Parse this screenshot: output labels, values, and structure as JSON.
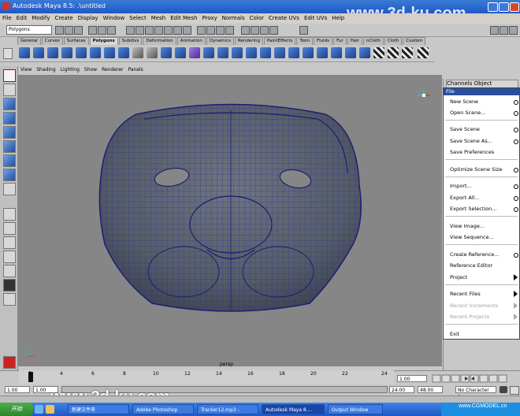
{
  "window": {
    "title": "Autodesk Maya 8.5: .\\untitled"
  },
  "menubar": [
    "File",
    "Edit",
    "Modify",
    "Create",
    "Display",
    "Window",
    "Select",
    "Mesh",
    "Edit Mesh",
    "Proxy",
    "Normals",
    "Color",
    "Create UVs",
    "Edit UVs",
    "Help"
  ],
  "statusline": {
    "mode": "Polygons"
  },
  "shelf": {
    "tabs": [
      "General",
      "Curves",
      "Surfaces",
      "Polygons",
      "Subdivs",
      "Deformation",
      "Animation",
      "Dynamics",
      "Rendering",
      "PaintEffects",
      "Toon",
      "Fluids",
      "Fur",
      "Hair",
      "nCloth",
      "Cloth",
      "Custom"
    ],
    "active_tab": "Polygons"
  },
  "panel_menu": [
    "View",
    "Shading",
    "Lighting",
    "Show",
    "Renderer",
    "Panels"
  ],
  "viewport": {
    "camera": "persp",
    "axis": "y z x"
  },
  "channel_box": {
    "header": "Channels Object"
  },
  "file_menu": {
    "title": "File",
    "items": [
      {
        "label": "New Scene",
        "option": true
      },
      {
        "label": "Open Scene...",
        "option": true
      },
      {
        "label": "Save Scene",
        "option": true
      },
      {
        "label": "Save Scene As...",
        "option": true
      },
      {
        "label": "Save Preferences",
        "option": false
      },
      {
        "label": "Optimize Scene Size",
        "option": true
      },
      {
        "label": "Import...",
        "option": true
      },
      {
        "label": "Export All...",
        "option": true
      },
      {
        "label": "Export Selection...",
        "option": true
      },
      {
        "label": "View Image...",
        "option": false
      },
      {
        "label": "View Sequence...",
        "option": false
      },
      {
        "label": "Create Reference...",
        "option": true
      },
      {
        "label": "Reference Editor",
        "option": false
      },
      {
        "label": "Project",
        "submenu": true
      },
      {
        "label": "Recent Files",
        "submenu": true
      },
      {
        "label": "Recent Increments",
        "submenu": true,
        "disabled": true
      },
      {
        "label": "Recent Projects",
        "submenu": true,
        "disabled": true
      },
      {
        "label": "Exit",
        "option": false
      }
    ]
  },
  "time_slider": {
    "ticks": [
      "1",
      "2",
      "4",
      "6",
      "8",
      "10",
      "12",
      "14",
      "16",
      "18",
      "20",
      "22",
      "24"
    ],
    "current": "1.00"
  },
  "range_slider": {
    "start": "1.00",
    "start2": "1.00",
    "end": "24.00",
    "end2": "48.00",
    "character_set": "No Character Se"
  },
  "taskbar": {
    "start": "开始",
    "tasks": [
      "新建文件夹",
      "Adobe Photoshop",
      "Tracker12.mp3 -",
      "Autodesk Maya 8....",
      "Output Window"
    ],
    "active_task": "Autodesk Maya 8....",
    "tray": "www.CGMODEL.cn"
  },
  "watermarks": {
    "top": "www.3d-ku.com",
    "bottom": "www.3d-ku.com",
    "tray": "www.CGMODEL.cn"
  },
  "colors": {
    "title_blue": "#1f58c6",
    "viewport_gray": "#868686",
    "wire_blue": "#2a2aa0",
    "menu_header": "#2a4e9c"
  }
}
